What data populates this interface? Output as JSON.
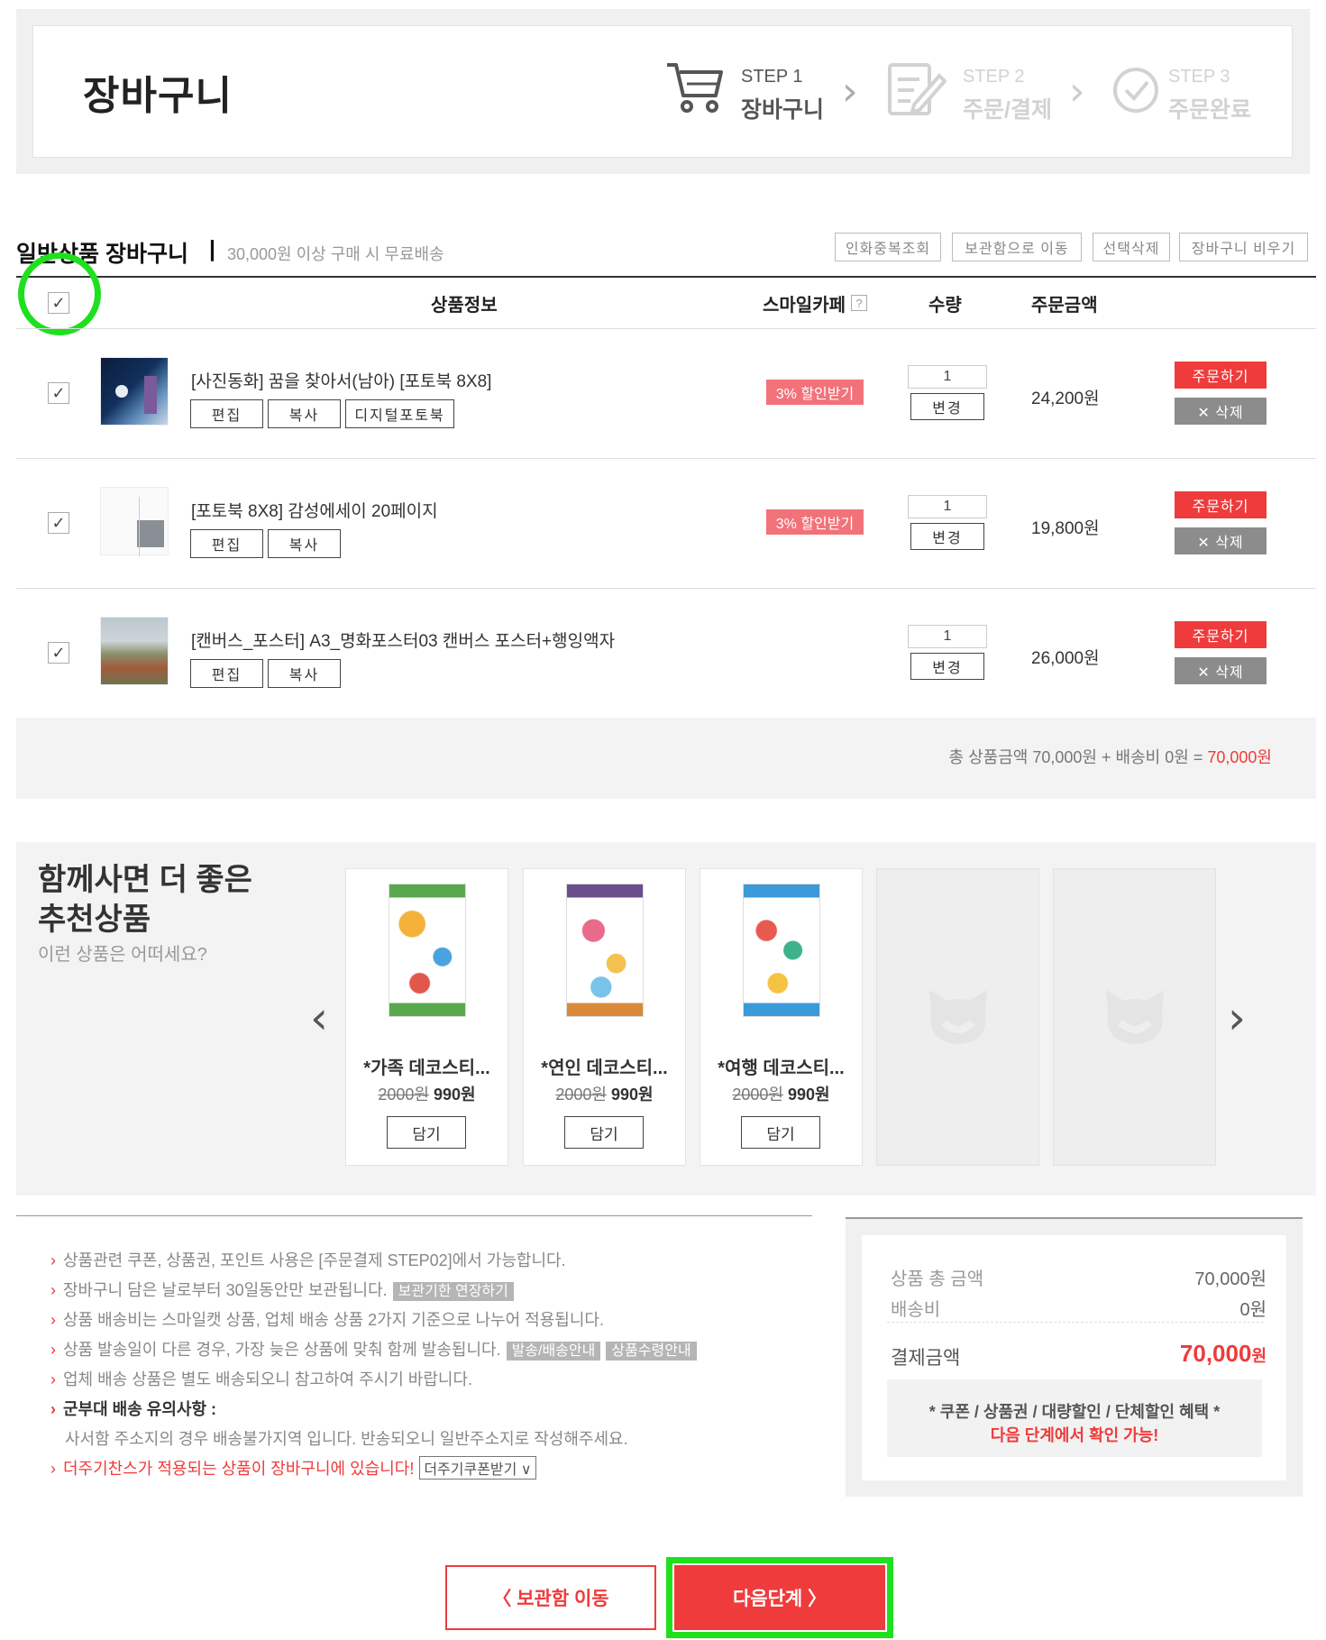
{
  "header": {
    "title": "장바구니",
    "steps": [
      {
        "small": "STEP 1",
        "big": "장바구니",
        "state": "active"
      },
      {
        "small": "STEP 2",
        "big": "주문/결제",
        "state": "inactive"
      },
      {
        "small": "STEP 3",
        "big": "주문완료",
        "state": "inactive"
      }
    ],
    "separator": "›"
  },
  "cart": {
    "title": "일반상품 장바구니",
    "separator": "|",
    "subtitle": "30,000원 이상 구매 시 무료배송",
    "actions": [
      "인화중복조회",
      "보관함으로 이동",
      "선택삭제",
      "장바구니 비우기"
    ],
    "columns": {
      "info": "상품정보",
      "smile": "스마일카페",
      "qty": "수량",
      "amount": "주문금액"
    },
    "help_icon": "?",
    "check_mark": "✓",
    "items": [
      {
        "name": "[사진동화] 꿈을 찾아서(남아) [포토북 8X8]",
        "buttons": [
          "편집",
          "복사",
          "디지털포토북"
        ],
        "discount": "3% 할인받기",
        "qty": "1",
        "change": "변경",
        "price": "24,200원",
        "order": "주문하기",
        "delete": "✕ 삭제"
      },
      {
        "name": "[포토북 8X8] 감성에세이 20페이지",
        "buttons": [
          "편집",
          "복사"
        ],
        "discount": "3% 할인받기",
        "qty": "1",
        "change": "변경",
        "price": "19,800원",
        "order": "주문하기",
        "delete": "✕ 삭제"
      },
      {
        "name": "[캔버스_포스터] A3_명화포스터03 캔버스 포스터+행잉액자",
        "buttons": [
          "편집",
          "복사"
        ],
        "discount": "",
        "qty": "1",
        "change": "변경",
        "price": "26,000원",
        "order": "주문하기",
        "delete": "✕ 삭제"
      }
    ],
    "total": {
      "label": "총 상품금액",
      "goods": "70,000원",
      "plus": "+",
      "ship_label": "배송비",
      "ship": "0원",
      "eq": "=",
      "sum": "70,000원"
    }
  },
  "recommend": {
    "title_line1": "함께사면 더 좋은",
    "title_line2": "추천상품",
    "subtitle": "이런 상품은 어떠세요?",
    "prev": "‹",
    "next": "›",
    "products": [
      {
        "name": "*가족 데코스티...",
        "old_price": "2000원",
        "price": "990원",
        "button": "담기"
      },
      {
        "name": "*연인 데코스티...",
        "old_price": "2000원",
        "price": "990원",
        "button": "담기"
      },
      {
        "name": "*여행 데코스티...",
        "old_price": "2000원",
        "price": "990원",
        "button": "담기"
      }
    ]
  },
  "notices": {
    "mark": "›",
    "n1": "상품관련 쿠폰, 상품권, 포인트 사용은 [주문결제 STEP02]에서 가능합니다.",
    "n2": "장바구니 담은 날로부터 30일동안만 보관됩니다.",
    "n2_tag": "보관기한 연장하기",
    "n3": "상품 배송비는 스마일캣 상품, 업체 배송 상품 2가지 기준으로 나누어 적용됩니다.",
    "n4": "상품 발송일이 다른 경우, 가장 늦은 상품에 맞춰 함께 발송됩니다.",
    "n4_tag1": "발송/배송안내",
    "n4_tag2": "상품수령안내",
    "n5": "업체 배송 상품은 별도 배송되오니 참고하여 주시기 바랍니다.",
    "n6": "군부대 배송 유의사항 :",
    "n6_sub": "사서함 주소지의 경우 배송불가지역 입니다. 반송되오니 일반주소지로 작성해주세요.",
    "n7": "더주기찬스가 적용되는 상품이 장바구니에 있습니다!",
    "n7_select": "더주기쿠폰받기"
  },
  "summary": {
    "goods_label": "상품 총 금액",
    "goods_value": "70,000원",
    "ship_label": "배송비",
    "ship_value": "0원",
    "pay_label": "결제금액",
    "pay_value": "70,000",
    "pay_unit": "원",
    "benefit_line1": "* 쿠폰 / 상품권 / 대량할인 / 단체할인 혜택 *",
    "benefit_line2": "다음 단계에서 확인 가능!"
  },
  "bottom": {
    "storage": "〈  보관함 이동",
    "next": "다음단계  〉"
  },
  "colors": {
    "accent": "#ef3b3b",
    "highlight": "#1fe01f"
  }
}
